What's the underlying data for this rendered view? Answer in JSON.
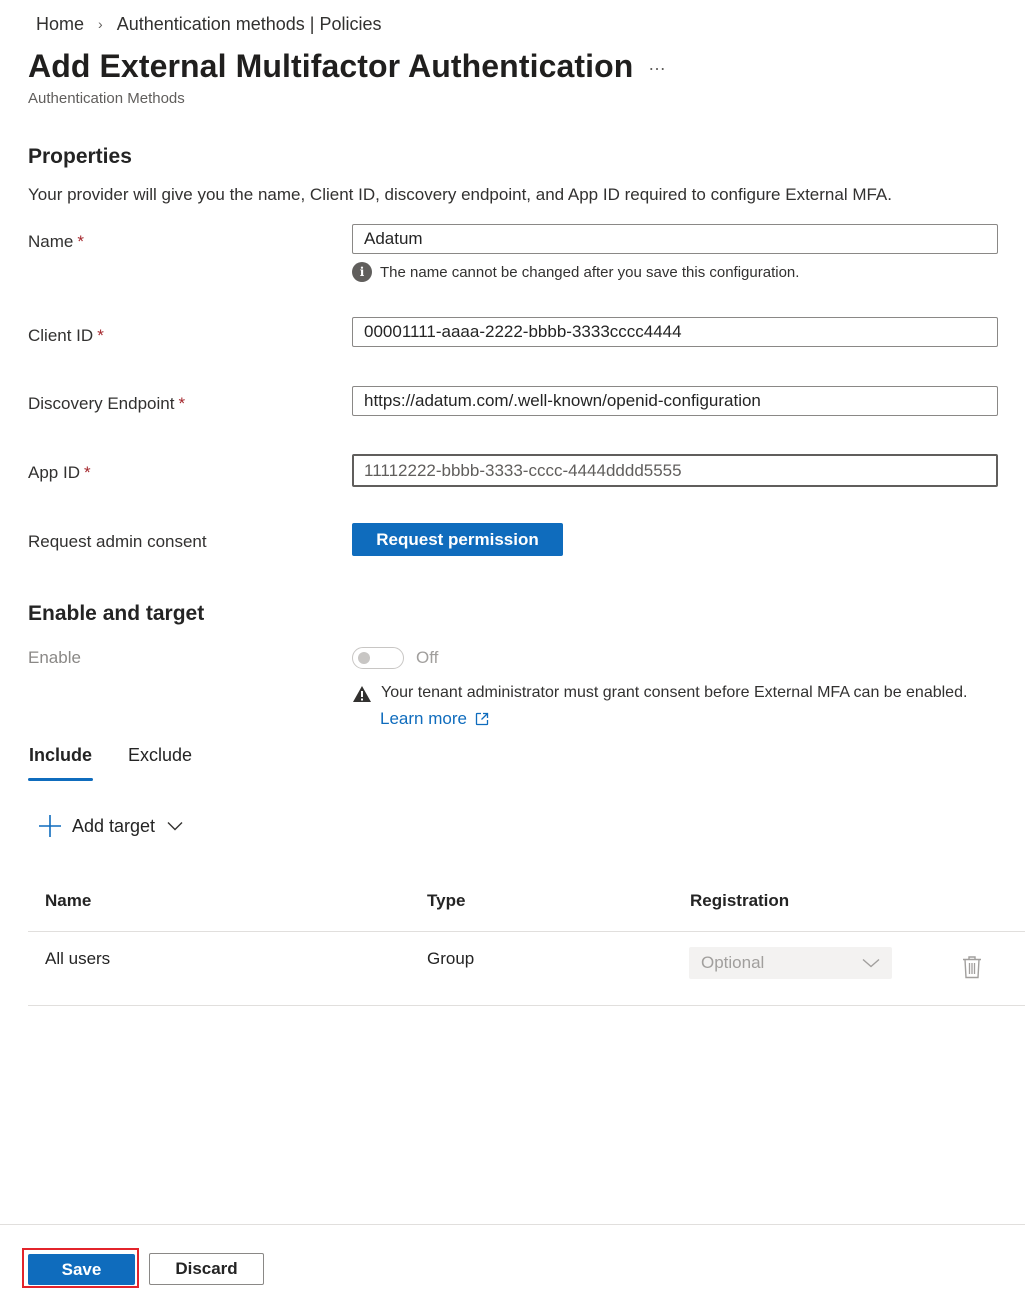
{
  "breadcrumb": {
    "home": "Home",
    "current": "Authentication methods | Policies"
  },
  "header": {
    "title": "Add External Multifactor Authentication",
    "more": "…",
    "subtitle": "Authentication Methods"
  },
  "properties": {
    "title": "Properties",
    "description": "Your provider will give you the name, Client ID, discovery endpoint, and App ID required to configure External MFA.",
    "required_mark": "*",
    "name": {
      "label": "Name",
      "value": "Adatum",
      "hint": "The name cannot be changed after you save this configuration."
    },
    "client_id": {
      "label": "Client ID",
      "value": "00001111-aaaa-2222-bbbb-3333cccc4444"
    },
    "discovery_endpoint": {
      "label": "Discovery Endpoint",
      "value": "https://adatum.com/.well-known/openid-configuration"
    },
    "app_id": {
      "label": "App ID",
      "value": "11112222-bbbb-3333-cccc-4444dddd5555"
    },
    "admin_consent": {
      "label": "Request admin consent",
      "button": "Request permission"
    }
  },
  "enable_target": {
    "title": "Enable and target",
    "enable_label": "Enable",
    "toggle_state": "Off",
    "toggle_on": false,
    "warning": "Your tenant administrator must grant consent before External MFA can be enabled.",
    "learn_more": "Learn more",
    "tabs": [
      {
        "label": "Include",
        "active": true
      },
      {
        "label": "Exclude",
        "active": false
      }
    ],
    "add_target": "Add target"
  },
  "table": {
    "headers": [
      "Name",
      "Type",
      "Registration"
    ],
    "rows": [
      {
        "name": "All users",
        "type": "Group",
        "registration": "Optional"
      }
    ]
  },
  "footer": {
    "save": "Save",
    "discard": "Discard"
  },
  "colors": {
    "accent": "#0f6cbd",
    "required": "#a4262c",
    "highlight": "#e3242b"
  }
}
